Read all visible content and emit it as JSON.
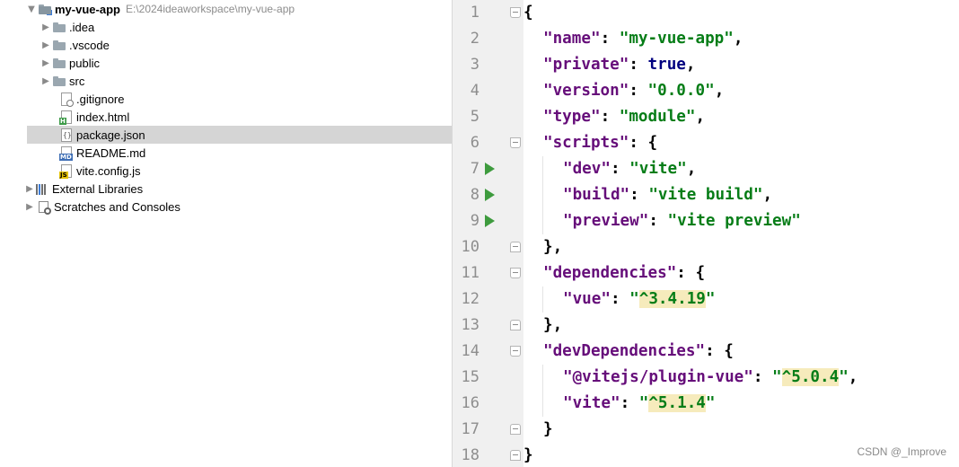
{
  "project_tree": {
    "root": {
      "label": "my-vue-app",
      "path": "E:\\2024ideaworkspace\\my-vue-app"
    },
    "items": [
      {
        "label": ".idea",
        "kind": "folder"
      },
      {
        "label": ".vscode",
        "kind": "folder"
      },
      {
        "label": "public",
        "kind": "folder"
      },
      {
        "label": "src",
        "kind": "folder"
      },
      {
        "label": ".gitignore",
        "kind": "file-gitignore"
      },
      {
        "label": "index.html",
        "kind": "file-html",
        "tag": "H"
      },
      {
        "label": "package.json",
        "kind": "file-json",
        "selected": true
      },
      {
        "label": "README.md",
        "kind": "file-md",
        "tag": "MD"
      },
      {
        "label": "vite.config.js",
        "kind": "file-js",
        "tag": "JS"
      }
    ],
    "external_libraries": "External Libraries",
    "scratches": "Scratches and Consoles"
  },
  "editor": {
    "lines": [
      {
        "n": "1",
        "tokens": [
          {
            "t": "{",
            "c": "p"
          }
        ]
      },
      {
        "n": "2",
        "tokens": [
          {
            "t": "\"name\"",
            "c": "k"
          },
          {
            "t": ": ",
            "c": "p"
          },
          {
            "t": "\"my-vue-app\"",
            "c": "s"
          },
          {
            "t": ",",
            "c": "p"
          }
        ]
      },
      {
        "n": "3",
        "tokens": [
          {
            "t": "\"private\"",
            "c": "k"
          },
          {
            "t": ": ",
            "c": "p"
          },
          {
            "t": "true",
            "c": "kw"
          },
          {
            "t": ",",
            "c": "p"
          }
        ]
      },
      {
        "n": "4",
        "tokens": [
          {
            "t": "\"version\"",
            "c": "k"
          },
          {
            "t": ": ",
            "c": "p"
          },
          {
            "t": "\"0.0.0\"",
            "c": "s"
          },
          {
            "t": ",",
            "c": "p"
          }
        ]
      },
      {
        "n": "5",
        "tokens": [
          {
            "t": "\"type\"",
            "c": "k"
          },
          {
            "t": ": ",
            "c": "p"
          },
          {
            "t": "\"module\"",
            "c": "s"
          },
          {
            "t": ",",
            "c": "p"
          }
        ]
      },
      {
        "n": "6",
        "tokens": [
          {
            "t": "\"scripts\"",
            "c": "k"
          },
          {
            "t": ": {",
            "c": "p"
          }
        ]
      },
      {
        "n": "7",
        "tokens": [
          {
            "t": "\"dev\"",
            "c": "k"
          },
          {
            "t": ": ",
            "c": "p"
          },
          {
            "t": "\"vite\"",
            "c": "s"
          },
          {
            "t": ",",
            "c": "p"
          }
        ]
      },
      {
        "n": "8",
        "tokens": [
          {
            "t": "\"build\"",
            "c": "k"
          },
          {
            "t": ": ",
            "c": "p"
          },
          {
            "t": "\"vite build\"",
            "c": "s"
          },
          {
            "t": ",",
            "c": "p"
          }
        ]
      },
      {
        "n": "9",
        "tokens": [
          {
            "t": "\"preview\"",
            "c": "k"
          },
          {
            "t": ": ",
            "c": "p"
          },
          {
            "t": "\"vite preview\"",
            "c": "s"
          }
        ]
      },
      {
        "n": "10",
        "tokens": [
          {
            "t": "},",
            "c": "p"
          }
        ]
      },
      {
        "n": "11",
        "tokens": [
          {
            "t": "\"dependencies\"",
            "c": "k"
          },
          {
            "t": ": {",
            "c": "p"
          }
        ]
      },
      {
        "n": "12",
        "tokens": [
          {
            "t": "\"vue\"",
            "c": "k"
          },
          {
            "t": ": ",
            "c": "p"
          },
          {
            "t": "\"",
            "c": "s"
          },
          {
            "t": "^3.4.19",
            "c": "s",
            "hl": true
          },
          {
            "t": "\"",
            "c": "s"
          }
        ]
      },
      {
        "n": "13",
        "tokens": [
          {
            "t": "},",
            "c": "p"
          }
        ]
      },
      {
        "n": "14",
        "tokens": [
          {
            "t": "\"devDependencies\"",
            "c": "k"
          },
          {
            "t": ": {",
            "c": "p"
          }
        ]
      },
      {
        "n": "15",
        "tokens": [
          {
            "t": "\"@vitejs/plugin-vue\"",
            "c": "k"
          },
          {
            "t": ": ",
            "c": "p"
          },
          {
            "t": "\"",
            "c": "s"
          },
          {
            "t": "^5.0.4",
            "c": "s",
            "hl": true
          },
          {
            "t": "\"",
            "c": "s"
          },
          {
            "t": ",",
            "c": "p"
          }
        ]
      },
      {
        "n": "16",
        "tokens": [
          {
            "t": "\"vite\"",
            "c": "k"
          },
          {
            "t": ": ",
            "c": "p"
          },
          {
            "t": "\"",
            "c": "s"
          },
          {
            "t": "^5.1.4",
            "c": "s",
            "hl": true
          },
          {
            "t": "\"",
            "c": "s"
          }
        ]
      },
      {
        "n": "17",
        "tokens": [
          {
            "t": "}",
            "c": "p"
          }
        ]
      },
      {
        "n": "18",
        "tokens": [
          {
            "t": "}",
            "c": "p"
          }
        ]
      }
    ]
  },
  "colors": {
    "key": "#660e7a",
    "string": "#067d17",
    "keyword": "#000080",
    "highlight": "#f6ebbc",
    "run": "#3e9b3e"
  },
  "watermark": "CSDN @_Improve"
}
